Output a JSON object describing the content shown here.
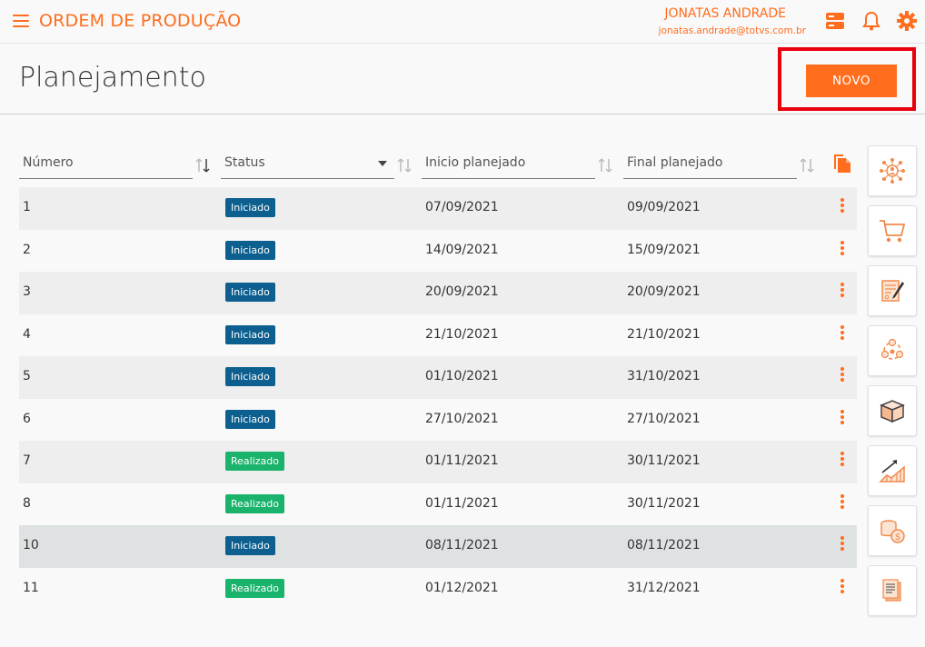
{
  "app": {
    "title": "ORDEM DE PRODUÇÃO",
    "user_name": "JONATAS ANDRADE",
    "user_email": "jonatas.andrade@totvs.com.br"
  },
  "page": {
    "title": "Planejamento",
    "new_button": "NOVO"
  },
  "table": {
    "columns": {
      "numero": "Número",
      "status": "Status",
      "inicio": "Inicio planejado",
      "final": "Final planejado"
    },
    "rows": [
      {
        "numero": "1",
        "status": "Iniciado",
        "inicio": "07/09/2021",
        "final": "09/09/2021"
      },
      {
        "numero": "2",
        "status": "Iniciado",
        "inicio": "14/09/2021",
        "final": "15/09/2021"
      },
      {
        "numero": "3",
        "status": "Iniciado",
        "inicio": "20/09/2021",
        "final": "20/09/2021"
      },
      {
        "numero": "4",
        "status": "Iniciado",
        "inicio": "21/10/2021",
        "final": "21/10/2021"
      },
      {
        "numero": "5",
        "status": "Iniciado",
        "inicio": "01/10/2021",
        "final": "31/10/2021"
      },
      {
        "numero": "6",
        "status": "Iniciado",
        "inicio": "27/10/2021",
        "final": "27/10/2021"
      },
      {
        "numero": "7",
        "status": "Realizado",
        "inicio": "01/11/2021",
        "final": "30/11/2021"
      },
      {
        "numero": "8",
        "status": "Realizado",
        "inicio": "01/11/2021",
        "final": "30/11/2021"
      },
      {
        "numero": "10",
        "status": "Iniciado",
        "inicio": "08/11/2021",
        "final": "08/11/2021"
      },
      {
        "numero": "11",
        "status": "Realizado",
        "inicio": "01/12/2021",
        "final": "31/12/2021"
      }
    ]
  },
  "colors": {
    "accent": "#ff6d1d",
    "iniciado": "#0c5f8e",
    "realizado": "#1ab36b",
    "highlight": "#e8000b"
  }
}
